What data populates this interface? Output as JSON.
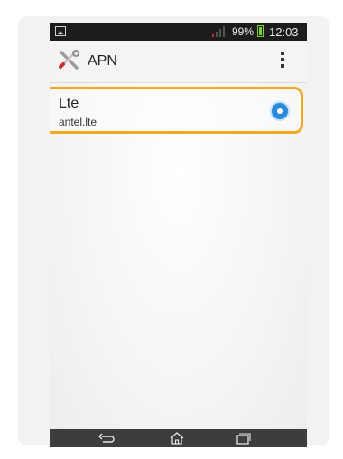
{
  "status_bar": {
    "battery_percent": "99%",
    "time": "12:03",
    "icons": [
      "gallery-icon",
      "signal-icon",
      "battery-icon"
    ],
    "signal_color": "#d9252a",
    "battery_color": "#7cd23a"
  },
  "action_bar": {
    "title": "APN",
    "icons": [
      "settings-tools-icon",
      "overflow-menu-icon"
    ]
  },
  "apn_list": {
    "items": [
      {
        "name": "Lte",
        "value": "antel.lte",
        "selected": true
      }
    ],
    "highlight_color": "#f2a91d",
    "radio_color": "#2c88d8"
  },
  "navigation_bar": {
    "buttons": [
      "back-icon",
      "home-icon",
      "recent-apps-icon"
    ]
  }
}
